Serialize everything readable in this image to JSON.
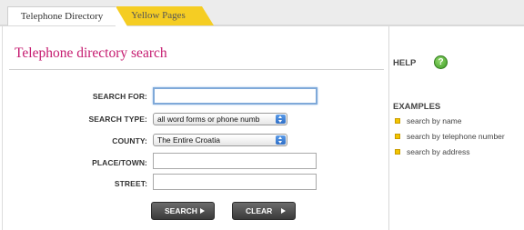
{
  "tabs": [
    {
      "label": "Telephone Directory",
      "active": true
    },
    {
      "label": "Yellow Pages",
      "active": false
    }
  ],
  "page_title": "Telephone directory search",
  "form": {
    "search_for": {
      "label": "SEARCH FOR:",
      "value": ""
    },
    "search_type": {
      "label": "SEARCH TYPE:",
      "selected": "all word forms or phone numb"
    },
    "county": {
      "label": "COUNTY:",
      "selected": "The Entire Croatia"
    },
    "place_town": {
      "label": "PLACE/TOWN:",
      "value": ""
    },
    "street": {
      "label": "STREET:",
      "value": ""
    }
  },
  "buttons": {
    "search": "SEARCH",
    "clear": "CLEAR"
  },
  "help": {
    "title": "HELP",
    "icon": "question-mark",
    "icon_glyph": "?"
  },
  "examples": {
    "title": "EXAMPLES",
    "items": [
      {
        "label": "search by name"
      },
      {
        "label": "search by telephone number"
      },
      {
        "label": "search by address"
      }
    ]
  },
  "colors": {
    "title": "#c51a6f",
    "yellow_tab": "#f5cd23",
    "help_icon": "#3f9c26",
    "bullet": "#f2c400"
  }
}
